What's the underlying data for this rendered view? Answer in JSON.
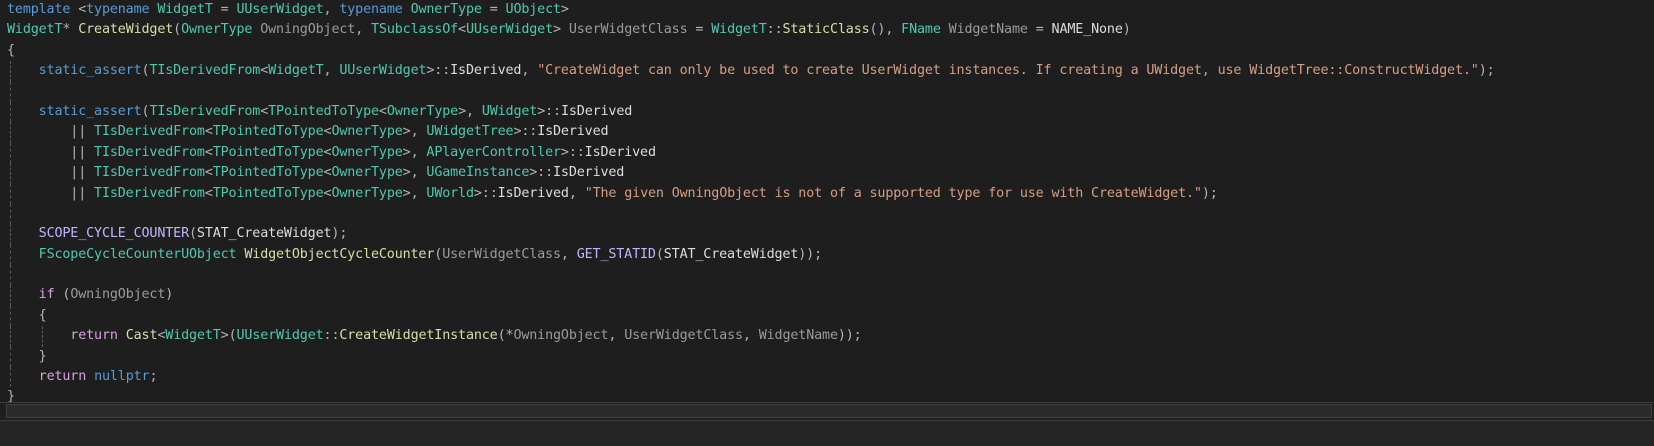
{
  "colors": {
    "background": "#1e1e1e",
    "keyword": "#569cd6",
    "control_keyword": "#d8a0df",
    "type": "#4ec9b0",
    "function": "#dcdcaa",
    "parameter": "#9a9a9a",
    "macro": "#beb7ff",
    "string": "#d69d85",
    "plain": "#dcdcdc"
  },
  "editor": {
    "lines": [
      {
        "indent": 0,
        "guides": [],
        "tokens": [
          {
            "t": "template",
            "c": "kw"
          },
          {
            "t": " <",
            "c": "op"
          },
          {
            "t": "typename",
            "c": "kw"
          },
          {
            "t": " ",
            "c": "pl"
          },
          {
            "t": "WidgetT",
            "c": "ty"
          },
          {
            "t": " = ",
            "c": "op"
          },
          {
            "t": "UUserWidget",
            "c": "ty"
          },
          {
            "t": ", ",
            "c": "op"
          },
          {
            "t": "typename",
            "c": "kw"
          },
          {
            "t": " ",
            "c": "pl"
          },
          {
            "t": "OwnerType",
            "c": "ty"
          },
          {
            "t": " = ",
            "c": "op"
          },
          {
            "t": "UObject",
            "c": "ty"
          },
          {
            "t": ">",
            "c": "op"
          }
        ]
      },
      {
        "indent": 0,
        "guides": [],
        "tokens": [
          {
            "t": "WidgetT",
            "c": "ty"
          },
          {
            "t": "* ",
            "c": "op"
          },
          {
            "t": "CreateWidget",
            "c": "fn"
          },
          {
            "t": "(",
            "c": "op"
          },
          {
            "t": "OwnerType",
            "c": "ty"
          },
          {
            "t": " ",
            "c": "pl"
          },
          {
            "t": "OwningObject",
            "c": "par"
          },
          {
            "t": ", ",
            "c": "op"
          },
          {
            "t": "TSubclassOf",
            "c": "ty"
          },
          {
            "t": "<",
            "c": "op"
          },
          {
            "t": "UUserWidget",
            "c": "ty"
          },
          {
            "t": "> ",
            "c": "op"
          },
          {
            "t": "UserWidgetClass",
            "c": "par"
          },
          {
            "t": " = ",
            "c": "op"
          },
          {
            "t": "WidgetT",
            "c": "ty"
          },
          {
            "t": "::",
            "c": "op"
          },
          {
            "t": "StaticClass",
            "c": "fn"
          },
          {
            "t": "(), ",
            "c": "op"
          },
          {
            "t": "FName",
            "c": "ty"
          },
          {
            "t": " ",
            "c": "pl"
          },
          {
            "t": "WidgetName",
            "c": "par"
          },
          {
            "t": " = ",
            "c": "op"
          },
          {
            "t": "NAME_None",
            "c": "pl"
          },
          {
            "t": ")",
            "c": "op"
          }
        ]
      },
      {
        "indent": 0,
        "guides": [],
        "tokens": [
          {
            "t": "{",
            "c": "op"
          }
        ]
      },
      {
        "indent": 0,
        "guides": [
          1
        ],
        "tokens": [
          {
            "t": "    ",
            "c": "pl"
          },
          {
            "t": "static_assert",
            "c": "kw"
          },
          {
            "t": "(",
            "c": "op"
          },
          {
            "t": "TIsDerivedFrom",
            "c": "ty"
          },
          {
            "t": "<",
            "c": "op"
          },
          {
            "t": "WidgetT",
            "c": "ty"
          },
          {
            "t": ", ",
            "c": "op"
          },
          {
            "t": "UUserWidget",
            "c": "ty"
          },
          {
            "t": ">::",
            "c": "op"
          },
          {
            "t": "IsDerived",
            "c": "pl"
          },
          {
            "t": ", ",
            "c": "op"
          },
          {
            "t": "\"CreateWidget can only be used to create UserWidget instances. If creating a UWidget, use WidgetTree::ConstructWidget.\"",
            "c": "str"
          },
          {
            "t": ");",
            "c": "op"
          }
        ]
      },
      {
        "indent": 0,
        "guides": [
          1
        ],
        "tokens": []
      },
      {
        "indent": 0,
        "guides": [
          1
        ],
        "tokens": [
          {
            "t": "    ",
            "c": "pl"
          },
          {
            "t": "static_assert",
            "c": "kw"
          },
          {
            "t": "(",
            "c": "op"
          },
          {
            "t": "TIsDerivedFrom",
            "c": "ty"
          },
          {
            "t": "<",
            "c": "op"
          },
          {
            "t": "TPointedToType",
            "c": "ty"
          },
          {
            "t": "<",
            "c": "op"
          },
          {
            "t": "OwnerType",
            "c": "ty"
          },
          {
            "t": ">, ",
            "c": "op"
          },
          {
            "t": "UWidget",
            "c": "ty"
          },
          {
            "t": ">::",
            "c": "op"
          },
          {
            "t": "IsDerived",
            "c": "pl"
          }
        ]
      },
      {
        "indent": 0,
        "guides": [
          1
        ],
        "tokens": [
          {
            "t": "        || ",
            "c": "op"
          },
          {
            "t": "TIsDerivedFrom",
            "c": "ty"
          },
          {
            "t": "<",
            "c": "op"
          },
          {
            "t": "TPointedToType",
            "c": "ty"
          },
          {
            "t": "<",
            "c": "op"
          },
          {
            "t": "OwnerType",
            "c": "ty"
          },
          {
            "t": ">, ",
            "c": "op"
          },
          {
            "t": "UWidgetTree",
            "c": "ty"
          },
          {
            "t": ">::",
            "c": "op"
          },
          {
            "t": "IsDerived",
            "c": "pl"
          }
        ]
      },
      {
        "indent": 0,
        "guides": [
          1
        ],
        "tokens": [
          {
            "t": "        || ",
            "c": "op"
          },
          {
            "t": "TIsDerivedFrom",
            "c": "ty"
          },
          {
            "t": "<",
            "c": "op"
          },
          {
            "t": "TPointedToType",
            "c": "ty"
          },
          {
            "t": "<",
            "c": "op"
          },
          {
            "t": "OwnerType",
            "c": "ty"
          },
          {
            "t": ">, ",
            "c": "op"
          },
          {
            "t": "APlayerController",
            "c": "ty"
          },
          {
            "t": ">::",
            "c": "op"
          },
          {
            "t": "IsDerived",
            "c": "pl"
          }
        ]
      },
      {
        "indent": 0,
        "guides": [
          1
        ],
        "tokens": [
          {
            "t": "        || ",
            "c": "op"
          },
          {
            "t": "TIsDerivedFrom",
            "c": "ty"
          },
          {
            "t": "<",
            "c": "op"
          },
          {
            "t": "TPointedToType",
            "c": "ty"
          },
          {
            "t": "<",
            "c": "op"
          },
          {
            "t": "OwnerType",
            "c": "ty"
          },
          {
            "t": ">, ",
            "c": "op"
          },
          {
            "t": "UGameInstance",
            "c": "ty"
          },
          {
            "t": ">::",
            "c": "op"
          },
          {
            "t": "IsDerived",
            "c": "pl"
          }
        ]
      },
      {
        "indent": 0,
        "guides": [
          1
        ],
        "tokens": [
          {
            "t": "        || ",
            "c": "op"
          },
          {
            "t": "TIsDerivedFrom",
            "c": "ty"
          },
          {
            "t": "<",
            "c": "op"
          },
          {
            "t": "TPointedToType",
            "c": "ty"
          },
          {
            "t": "<",
            "c": "op"
          },
          {
            "t": "OwnerType",
            "c": "ty"
          },
          {
            "t": ">, ",
            "c": "op"
          },
          {
            "t": "UWorld",
            "c": "ty"
          },
          {
            "t": ">::",
            "c": "op"
          },
          {
            "t": "IsDerived",
            "c": "pl"
          },
          {
            "t": ", ",
            "c": "op"
          },
          {
            "t": "\"The given OwningObject is not of a supported type for use with CreateWidget.\"",
            "c": "str"
          },
          {
            "t": ");",
            "c": "op"
          }
        ]
      },
      {
        "indent": 0,
        "guides": [
          1
        ],
        "tokens": []
      },
      {
        "indent": 0,
        "guides": [
          1
        ],
        "tokens": [
          {
            "t": "    ",
            "c": "pl"
          },
          {
            "t": "SCOPE_CYCLE_COUNTER",
            "c": "mac"
          },
          {
            "t": "(",
            "c": "op"
          },
          {
            "t": "STAT_CreateWidget",
            "c": "pl"
          },
          {
            "t": ");",
            "c": "op"
          }
        ]
      },
      {
        "indent": 0,
        "guides": [
          1
        ],
        "tokens": [
          {
            "t": "    ",
            "c": "pl"
          },
          {
            "t": "FScopeCycleCounterUObject",
            "c": "ty"
          },
          {
            "t": " ",
            "c": "pl"
          },
          {
            "t": "WidgetObjectCycleCounter",
            "c": "fn"
          },
          {
            "t": "(",
            "c": "op"
          },
          {
            "t": "UserWidgetClass",
            "c": "par"
          },
          {
            "t": ", ",
            "c": "op"
          },
          {
            "t": "GET_STATID",
            "c": "mac"
          },
          {
            "t": "(",
            "c": "op"
          },
          {
            "t": "STAT_CreateWidget",
            "c": "pl"
          },
          {
            "t": "));",
            "c": "op"
          }
        ]
      },
      {
        "indent": 0,
        "guides": [
          1
        ],
        "tokens": []
      },
      {
        "indent": 0,
        "guides": [
          1
        ],
        "tokens": [
          {
            "t": "    ",
            "c": "pl"
          },
          {
            "t": "if",
            "c": "kw2"
          },
          {
            "t": " (",
            "c": "op"
          },
          {
            "t": "OwningObject",
            "c": "par"
          },
          {
            "t": ")",
            "c": "op"
          }
        ]
      },
      {
        "indent": 0,
        "guides": [
          1
        ],
        "tokens": [
          {
            "t": "    ",
            "c": "pl"
          },
          {
            "t": "{",
            "c": "op"
          }
        ]
      },
      {
        "indent": 0,
        "guides": [
          1,
          2
        ],
        "tokens": [
          {
            "t": "        ",
            "c": "pl"
          },
          {
            "t": "return",
            "c": "kw2"
          },
          {
            "t": " ",
            "c": "pl"
          },
          {
            "t": "Cast",
            "c": "fn"
          },
          {
            "t": "<",
            "c": "op"
          },
          {
            "t": "WidgetT",
            "c": "ty"
          },
          {
            "t": ">(",
            "c": "op"
          },
          {
            "t": "UUserWidget",
            "c": "ty"
          },
          {
            "t": "::",
            "c": "op"
          },
          {
            "t": "CreateWidgetInstance",
            "c": "fn"
          },
          {
            "t": "(*",
            "c": "op"
          },
          {
            "t": "OwningObject",
            "c": "par"
          },
          {
            "t": ", ",
            "c": "op"
          },
          {
            "t": "UserWidgetClass",
            "c": "par"
          },
          {
            "t": ", ",
            "c": "op"
          },
          {
            "t": "WidgetName",
            "c": "par"
          },
          {
            "t": "));",
            "c": "op"
          }
        ]
      },
      {
        "indent": 0,
        "guides": [
          1
        ],
        "tokens": [
          {
            "t": "    ",
            "c": "pl"
          },
          {
            "t": "}",
            "c": "op"
          }
        ]
      },
      {
        "indent": 0,
        "guides": [
          1
        ],
        "tokens": [
          {
            "t": "    ",
            "c": "pl"
          },
          {
            "t": "return",
            "c": "kw2"
          },
          {
            "t": " ",
            "c": "pl"
          },
          {
            "t": "nullptr",
            "c": "kw"
          },
          {
            "t": ";",
            "c": "op"
          }
        ]
      },
      {
        "indent": 0,
        "guides": [],
        "tokens": [
          {
            "t": "}",
            "c": "op"
          }
        ]
      }
    ]
  }
}
